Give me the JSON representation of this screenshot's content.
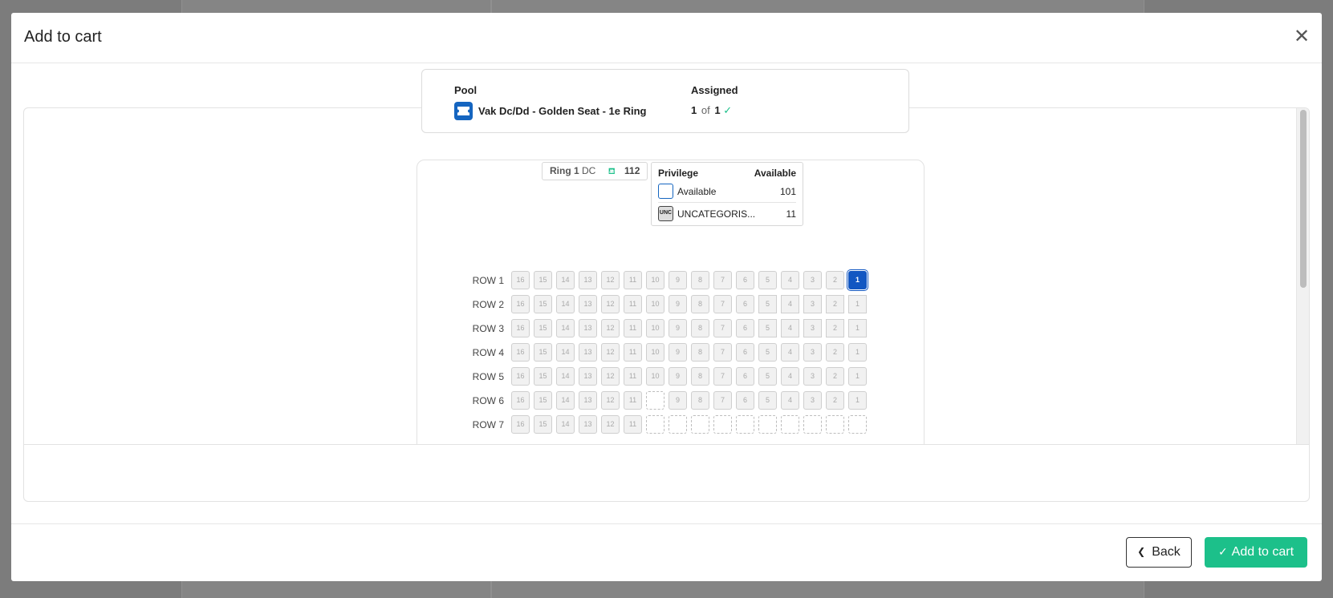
{
  "modal": {
    "title": "Add to cart",
    "close_icon": "close-icon"
  },
  "pool_card": {
    "pool_label": "Pool",
    "pool_name": "Vak Dc/Dd - Golden Seat - 1e Ring",
    "pool_icon": "ticket-icon",
    "assigned_label": "Assigned",
    "assigned_count": "1",
    "assigned_of": "of",
    "assigned_total": "1",
    "assigned_icon": "check-icon"
  },
  "seatmap": {
    "ring_tag": {
      "ring": "Ring 1",
      "section": "DC",
      "seat_icon": "seat-icon",
      "count": "112"
    },
    "legend": {
      "col_privilege": "Privilege",
      "col_available": "Available",
      "items": [
        {
          "label": "Available",
          "count": "101",
          "swatch_text": ""
        },
        {
          "label": "UNCATEGORIS...",
          "count": "11",
          "swatch_text": "UNC"
        }
      ]
    },
    "rows": [
      {
        "label": "ROW 1",
        "seats": [
          "16",
          "15",
          "14",
          "13",
          "12",
          "11",
          "10",
          "9",
          "8",
          "7",
          "6",
          "5",
          "4",
          "3",
          "2",
          "1"
        ],
        "selected": [
          "1"
        ],
        "empty": []
      },
      {
        "label": "ROW 2",
        "seats": [
          "16",
          "15",
          "14",
          "13",
          "12",
          "11",
          "10",
          "9",
          "8",
          "7",
          "6",
          "5",
          "4",
          "3",
          "2",
          "1"
        ],
        "selected": [],
        "empty": []
      },
      {
        "label": "ROW 3",
        "seats": [
          "16",
          "15",
          "14",
          "13",
          "12",
          "11",
          "10",
          "9",
          "8",
          "7",
          "6",
          "5",
          "4",
          "3",
          "2",
          "1"
        ],
        "selected": [],
        "empty": []
      },
      {
        "label": "ROW 4",
        "seats": [
          "16",
          "15",
          "14",
          "13",
          "12",
          "11",
          "10",
          "9",
          "8",
          "7",
          "6",
          "5",
          "4",
          "3",
          "2",
          "1"
        ],
        "selected": [],
        "empty": []
      },
      {
        "label": "ROW 5",
        "seats": [
          "16",
          "15",
          "14",
          "13",
          "12",
          "11",
          "10",
          "9",
          "8",
          "7",
          "6",
          "5",
          "4",
          "3",
          "2",
          "1"
        ],
        "selected": [],
        "empty": []
      },
      {
        "label": "ROW 6",
        "seats": [
          "16",
          "15",
          "14",
          "13",
          "12",
          "11",
          "",
          "9",
          "8",
          "7",
          "6",
          "5",
          "4",
          "3",
          "2",
          "1"
        ],
        "selected": [],
        "empty": [
          6
        ]
      },
      {
        "label": "ROW 7",
        "seats": [
          "16",
          "15",
          "14",
          "13",
          "12",
          "11",
          "",
          "",
          "",
          "",
          "",
          "",
          "",
          "",
          "",
          ""
        ],
        "selected": [],
        "empty": [
          6,
          7,
          8,
          9,
          10,
          11,
          12,
          13,
          14,
          15
        ]
      }
    ]
  },
  "footer": {
    "back_label": "Back",
    "back_icon": "chevron-left-icon",
    "add_label": "Add to cart",
    "add_icon": "check-icon"
  },
  "colors": {
    "primary": "#1257c2",
    "success": "#1cc08a"
  }
}
